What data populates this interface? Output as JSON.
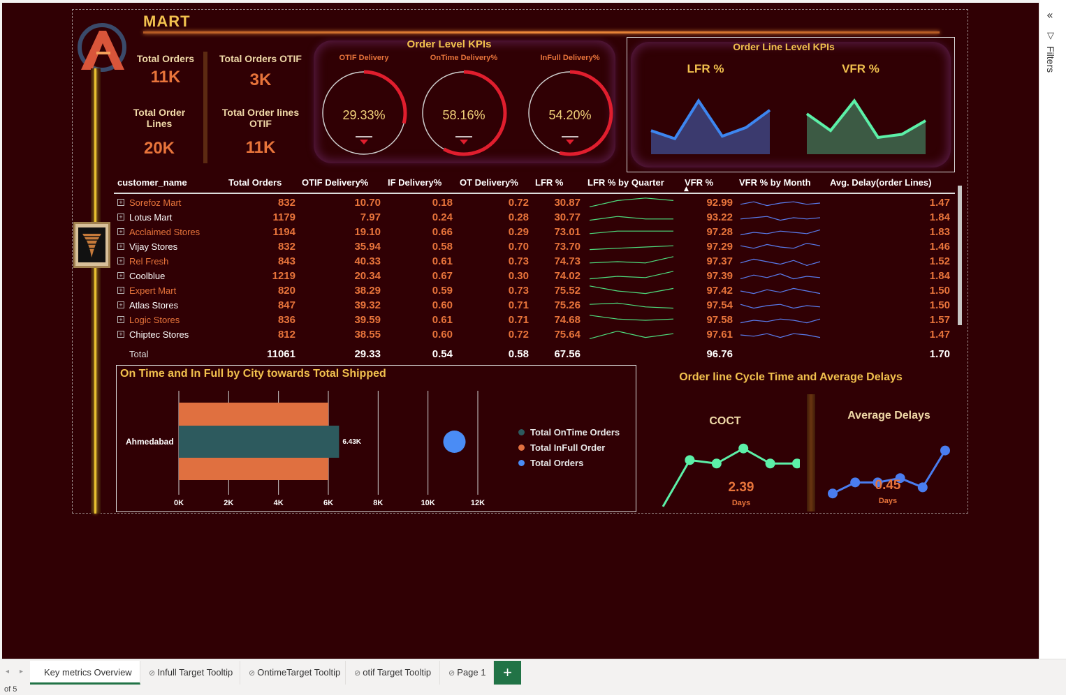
{
  "report": {
    "title": "MART"
  },
  "kpis": {
    "total_orders": {
      "label": "Total Orders",
      "value": "11K"
    },
    "total_orders_otif": {
      "label": "Total Orders OTIF",
      "value": "3K"
    },
    "total_order_lines": {
      "label": "Total Order Lines",
      "value": "20K"
    },
    "total_order_lines_otif": {
      "label": "Total Order lines OTIF",
      "value": "11K"
    }
  },
  "order_level": {
    "title": "Order Level KPIs",
    "gauges": [
      {
        "label": "OTIF Delivery",
        "value": "29.33%",
        "fraction": 0.29
      },
      {
        "label": "OnTime Delivery%",
        "value": "58.16%",
        "fraction": 0.58
      },
      {
        "label": "InFull Delivery%",
        "value": "54.20%",
        "fraction": 0.54
      }
    ]
  },
  "order_line_level": {
    "title": "Order Line Level KPIs",
    "lfr_label": "LFR %",
    "vfr_label": "VFR %",
    "lfr_series": [
      0.38,
      0.25,
      0.86,
      0.29,
      0.43,
      0.71
    ],
    "vfr_series": [
      0.65,
      0.38,
      0.86,
      0.27,
      0.32,
      0.54
    ]
  },
  "table": {
    "headers": [
      "customer_name",
      "Total Orders",
      "OTIF Delivery%",
      "IF Delivery%",
      "OT Delivery%",
      "LFR %",
      "LFR % by Quarter",
      "VFR %",
      "VFR % by Month",
      "Avg. Delay(order Lines)"
    ],
    "rows": [
      {
        "name": "Sorefoz Mart",
        "orders": "832",
        "otif": "10.70",
        "if": "0.18",
        "ot": "0.72",
        "lfr": "30.87",
        "vfr": "92.99",
        "delay": "1.47",
        "highlight": false
      },
      {
        "name": "Lotus Mart",
        "orders": "1179",
        "otif": "7.97",
        "if": "0.24",
        "ot": "0.28",
        "lfr": "30.77",
        "vfr": "93.22",
        "delay": "1.84",
        "highlight": true
      },
      {
        "name": "Acclaimed Stores",
        "orders": "1194",
        "otif": "19.10",
        "if": "0.66",
        "ot": "0.29",
        "lfr": "73.01",
        "vfr": "97.28",
        "delay": "1.83",
        "highlight": false
      },
      {
        "name": "Vijay Stores",
        "orders": "832",
        "otif": "35.94",
        "if": "0.58",
        "ot": "0.70",
        "lfr": "73.70",
        "vfr": "97.29",
        "delay": "1.46",
        "highlight": true
      },
      {
        "name": "Rel Fresh",
        "orders": "843",
        "otif": "40.33",
        "if": "0.61",
        "ot": "0.73",
        "lfr": "74.73",
        "vfr": "97.37",
        "delay": "1.52",
        "highlight": false
      },
      {
        "name": "Coolblue",
        "orders": "1219",
        "otif": "20.34",
        "if": "0.67",
        "ot": "0.30",
        "lfr": "74.02",
        "vfr": "97.39",
        "delay": "1.84",
        "highlight": true
      },
      {
        "name": "Expert Mart",
        "orders": "820",
        "otif": "38.29",
        "if": "0.59",
        "ot": "0.73",
        "lfr": "75.52",
        "vfr": "97.42",
        "delay": "1.50",
        "highlight": false
      },
      {
        "name": "Atlas Stores",
        "orders": "847",
        "otif": "39.32",
        "if": "0.60",
        "ot": "0.71",
        "lfr": "75.26",
        "vfr": "97.54",
        "delay": "1.50",
        "highlight": true
      },
      {
        "name": "Logic Stores",
        "orders": "836",
        "otif": "39.59",
        "if": "0.61",
        "ot": "0.71",
        "lfr": "74.68",
        "vfr": "97.58",
        "delay": "1.57",
        "highlight": false
      },
      {
        "name": "Chiptec Stores",
        "orders": "812",
        "otif": "38.55",
        "if": "0.60",
        "ot": "0.72",
        "lfr": "75.64",
        "vfr": "97.61",
        "delay": "1.47",
        "highlight": true
      }
    ],
    "total": {
      "name": "Total",
      "orders": "11061",
      "otif": "29.33",
      "if": "0.54",
      "ot": "0.58",
      "lfr": "67.56",
      "vfr": "96.76",
      "delay": "1.70"
    }
  },
  "city_chart": {
    "title": "On Time and In Full by City towards Total Shipped",
    "category": "Ahmedabad",
    "data_label": "6.43K",
    "ticks": [
      "0K",
      "2K",
      "4K",
      "6K",
      "8K",
      "10K",
      "12K"
    ],
    "legend": [
      "Total OnTime Orders",
      "Total InFull Order",
      "Total Orders"
    ],
    "colors": {
      "ontime": "#2d5a5e",
      "infull": "#e07040",
      "total": "#4a8cf5"
    }
  },
  "chart_data": {
    "type": "bar",
    "title": "On Time and In Full by City towards Total Shipped",
    "categories": [
      "Ahmedabad"
    ],
    "series": [
      {
        "name": "Total OnTime Orders",
        "values": [
          6430
        ]
      },
      {
        "name": "Total InFull Order",
        "values": [
          6000
        ]
      },
      {
        "name": "Total Orders",
        "values": [
          11061
        ]
      }
    ],
    "xlim": [
      0,
      12000
    ]
  },
  "cycle": {
    "title": "Order line Cycle Time and Average Delays",
    "coct_label": "COCT",
    "coct_value": "2.39",
    "coct_unit": "Days",
    "delay_label": "Average Delays",
    "delay_value": "0.45",
    "delay_unit": "Days",
    "coct_series": [
      0.0,
      0.68,
      0.63,
      0.85,
      0.63,
      0.63
    ],
    "delay_series": [
      0.1,
      0.28,
      0.28,
      0.35,
      0.2,
      0.8
    ]
  },
  "tabs": [
    "Key metrics Overview",
    "Infull Target Tooltip",
    "OntimeTarget Tooltip",
    "otif Target Tooltip",
    "Page 1"
  ],
  "status": {
    "page": "of 5"
  },
  "pane": {
    "filters": "Filters"
  }
}
